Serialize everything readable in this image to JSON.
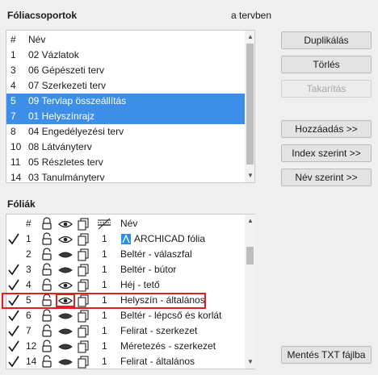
{
  "groups_title": "Fóliacsoportok",
  "plan_label": "a tervben",
  "groups_list": {
    "header_num": "#",
    "header_name": "Név",
    "rows": [
      {
        "num": "1",
        "name": "02 Vázlatok",
        "selected": false
      },
      {
        "num": "3",
        "name": "06 Gépészeti terv",
        "selected": false
      },
      {
        "num": "4",
        "name": "07 Szerkezeti terv",
        "selected": false
      },
      {
        "num": "5",
        "name": "09 Tervlap összeállítás",
        "selected": true
      },
      {
        "num": "7",
        "name": "01 Helyszínrajz",
        "selected": true
      },
      {
        "num": "8",
        "name": "04 Engedélyezési terv",
        "selected": false
      },
      {
        "num": "10",
        "name": "08 Látványterv",
        "selected": false
      },
      {
        "num": "11",
        "name": "05 Részletes terv",
        "selected": false
      },
      {
        "num": "14",
        "name": "03 Tanulmányterv",
        "selected": false
      }
    ]
  },
  "buttons": {
    "duplicate": "Duplikálás",
    "delete": "Törlés",
    "cleanup": "Takarítás",
    "add": "Hozzáadás >>",
    "by_index": "Index szerint >>",
    "by_name": "Név szerint >>",
    "save_txt": "Mentés TXT fájlba"
  },
  "layers_title": "Fóliák",
  "layers_list": {
    "header_num": "#",
    "header_name": "Név",
    "header_icons": [
      "lock-icon",
      "eye-icon",
      "layer-copy-icon",
      "pen-width-icon"
    ],
    "rows": [
      {
        "checked": true,
        "num": "1",
        "eye": "open",
        "pen": "1",
        "name": "ARCHICAD fólia",
        "special_icon": "archicad-layer-icon"
      },
      {
        "checked": false,
        "num": "2",
        "eye": "solid",
        "pen": "1",
        "name": "Beltér - válaszfal"
      },
      {
        "checked": true,
        "num": "3",
        "eye": "solid",
        "pen": "1",
        "name": "Beltér - bútor"
      },
      {
        "checked": true,
        "num": "4",
        "eye": "open",
        "pen": "1",
        "name": "Héj - tető"
      },
      {
        "checked": true,
        "num": "5",
        "eye": "open",
        "pen": "1",
        "name": "Helyszín - általános",
        "highlighted": true
      },
      {
        "checked": true,
        "num": "6",
        "eye": "solid",
        "pen": "1",
        "name": "Beltér - lépcső és korlát"
      },
      {
        "checked": true,
        "num": "7",
        "eye": "solid",
        "pen": "1",
        "name": "Felirat - szerkezet"
      },
      {
        "checked": true,
        "num": "12",
        "eye": "solid",
        "pen": "1",
        "name": "Méretezés - szerkezet"
      },
      {
        "checked": true,
        "num": "14",
        "eye": "solid",
        "pen": "1",
        "name": "Felirat - általános"
      }
    ]
  },
  "colors": {
    "selection": "#3d8ee8",
    "highlight": "#e02020"
  }
}
